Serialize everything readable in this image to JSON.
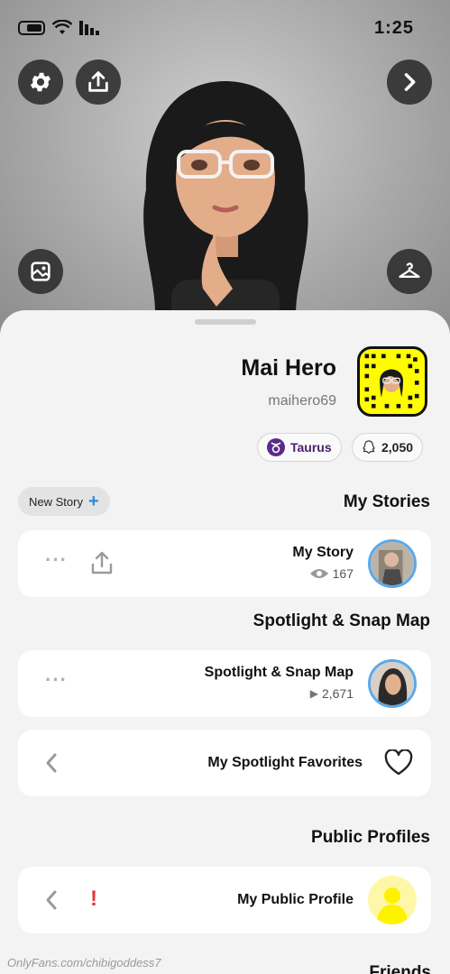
{
  "status_bar": {
    "time": "1:25"
  },
  "profile": {
    "display_name": "Mai Hero",
    "username": "maihero69",
    "zodiac": "Taurus",
    "snap_score": "2,050"
  },
  "stories": {
    "section_title": "My Stories",
    "new_story_label": "New Story",
    "my_story": {
      "title": "My Story",
      "views": "167"
    }
  },
  "spotlight": {
    "section_title": "Spotlight & Snap Map",
    "item": {
      "title": "Spotlight & Snap Map",
      "plays": "2,671"
    },
    "favorites_label": "My Spotlight Favorites"
  },
  "public_profiles": {
    "section_title": "Public Profiles",
    "item_label": "My Public Profile",
    "alert_mark": "!"
  },
  "friends": {
    "section_title": "Friends"
  },
  "watermark": "OnlyFans.com/chibigoddess7",
  "colors": {
    "snap_yellow": "#fffc00",
    "story_ring": "#59a9ea",
    "alert_red": "#e53935",
    "zodiac_purple": "#5b2b8a"
  }
}
